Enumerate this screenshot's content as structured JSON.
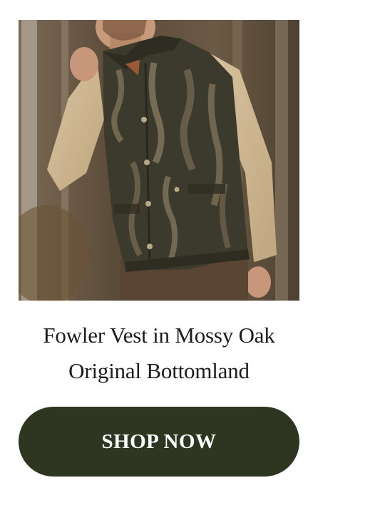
{
  "product": {
    "image_alt": "Man wearing camouflage vest over tan shirt",
    "title_line1": "Fowler Vest in Mossy Oak",
    "title_line2": "Original Bottomland",
    "cta_label": "SHOP NOW"
  },
  "colors": {
    "button_bg": "#2e3520",
    "button_text": "#ffffff",
    "title_text": "#1c1c1c",
    "page_bg": "#ffffff"
  }
}
